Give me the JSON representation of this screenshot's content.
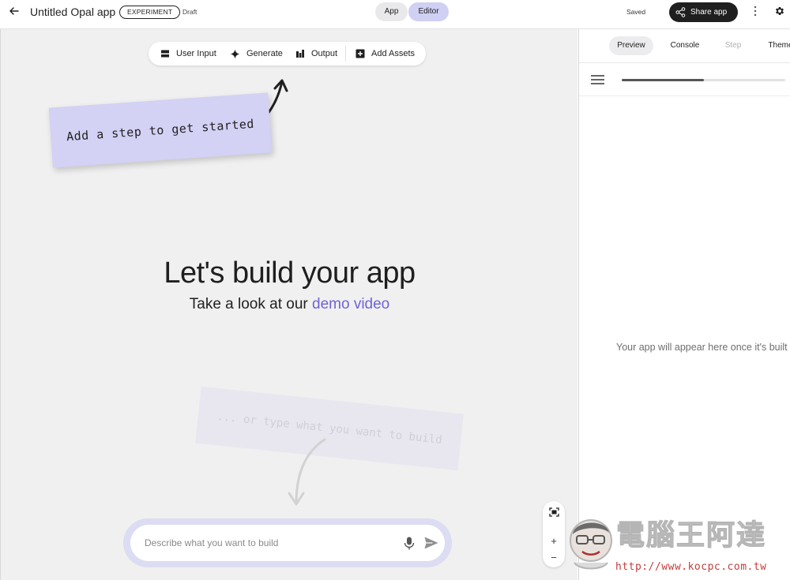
{
  "topbar": {
    "app_title": "Untitled Opal app",
    "badge": "EXPERIMENT",
    "status": "Draft",
    "mode_app": "App",
    "mode_editor": "Editor",
    "saved": "Saved",
    "share": "Share app"
  },
  "toolbar": {
    "user_input": "User Input",
    "generate": "Generate",
    "output": "Output",
    "add_assets": "Add Assets"
  },
  "canvas": {
    "sticky_note": "Add a step to get started",
    "hero_title": "Let's build your app",
    "hero_sub_prefix": "Take a look at our",
    "hero_sub_link": "demo video",
    "ghost_note": "... or type what you want to build",
    "prompt_placeholder": "Describe what you want to build",
    "zoom_in": "+",
    "zoom_out": "−"
  },
  "panel": {
    "tabs": [
      {
        "label": "Preview",
        "state": "active"
      },
      {
        "label": "Console",
        "state": "normal"
      },
      {
        "label": "Step",
        "state": "disabled"
      },
      {
        "label": "Theme",
        "state": "normal"
      }
    ],
    "progress": 0.5,
    "empty_message": "Your app will appear here once it's built"
  },
  "watermark": {
    "title": "電腦王阿達",
    "url": "http://www.kocpc.com.tw"
  },
  "colors": {
    "accent": "#6e63d6",
    "editor_tab": "#cfd0f3",
    "sticky": "#d3d1f4",
    "share_button": "#1f1f1f"
  }
}
